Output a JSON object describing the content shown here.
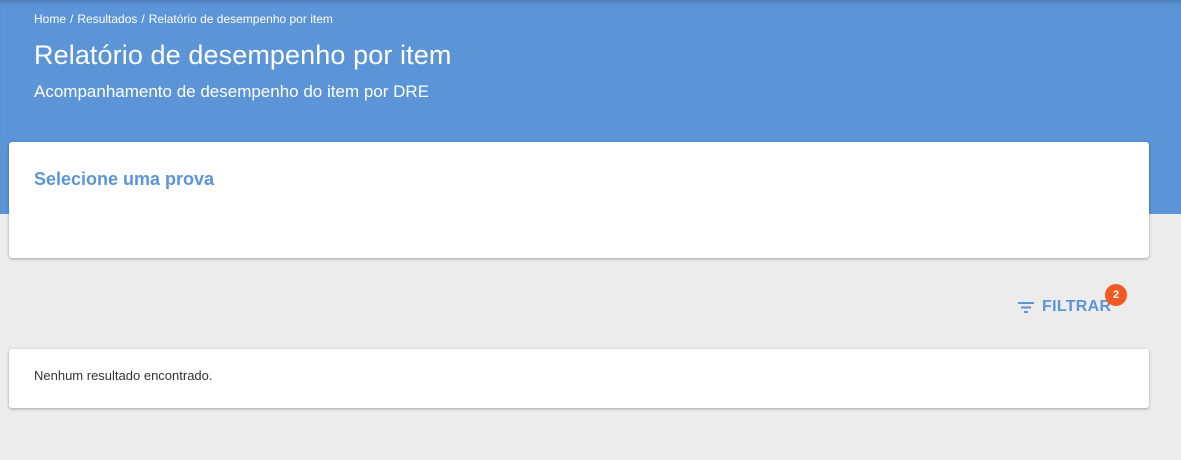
{
  "breadcrumb": {
    "items": [
      "Home",
      "Resultados",
      "Relatório de desempenho por item"
    ],
    "separator": "/"
  },
  "header": {
    "title": "Relatório de desempenho por item",
    "subtitle": "Acompanhamento de desempenho do item por DRE"
  },
  "select_card": {
    "title": "Selecione uma prova"
  },
  "filter": {
    "icon": "filter-list-icon",
    "label": "FILTRAR",
    "badge_count": "2"
  },
  "results": {
    "empty_message": "Nenhum resultado encontrado."
  },
  "colors": {
    "header_background": "#5b95d7",
    "page_background": "#ececec",
    "accent": "#5b95d7",
    "badge": "#f05a22"
  }
}
